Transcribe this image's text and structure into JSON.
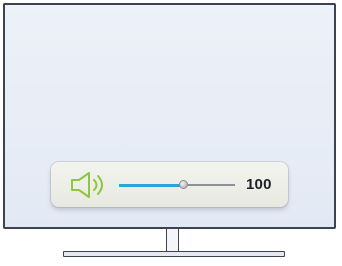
{
  "volume_osd": {
    "icon": "speaker-icon",
    "level": 100,
    "level_label": "100",
    "slider_fraction": 0.56,
    "colors": {
      "icon": "#8dc63f",
      "slider_fill": "#2aa6d6",
      "slider_track": "#8d9096"
    }
  }
}
